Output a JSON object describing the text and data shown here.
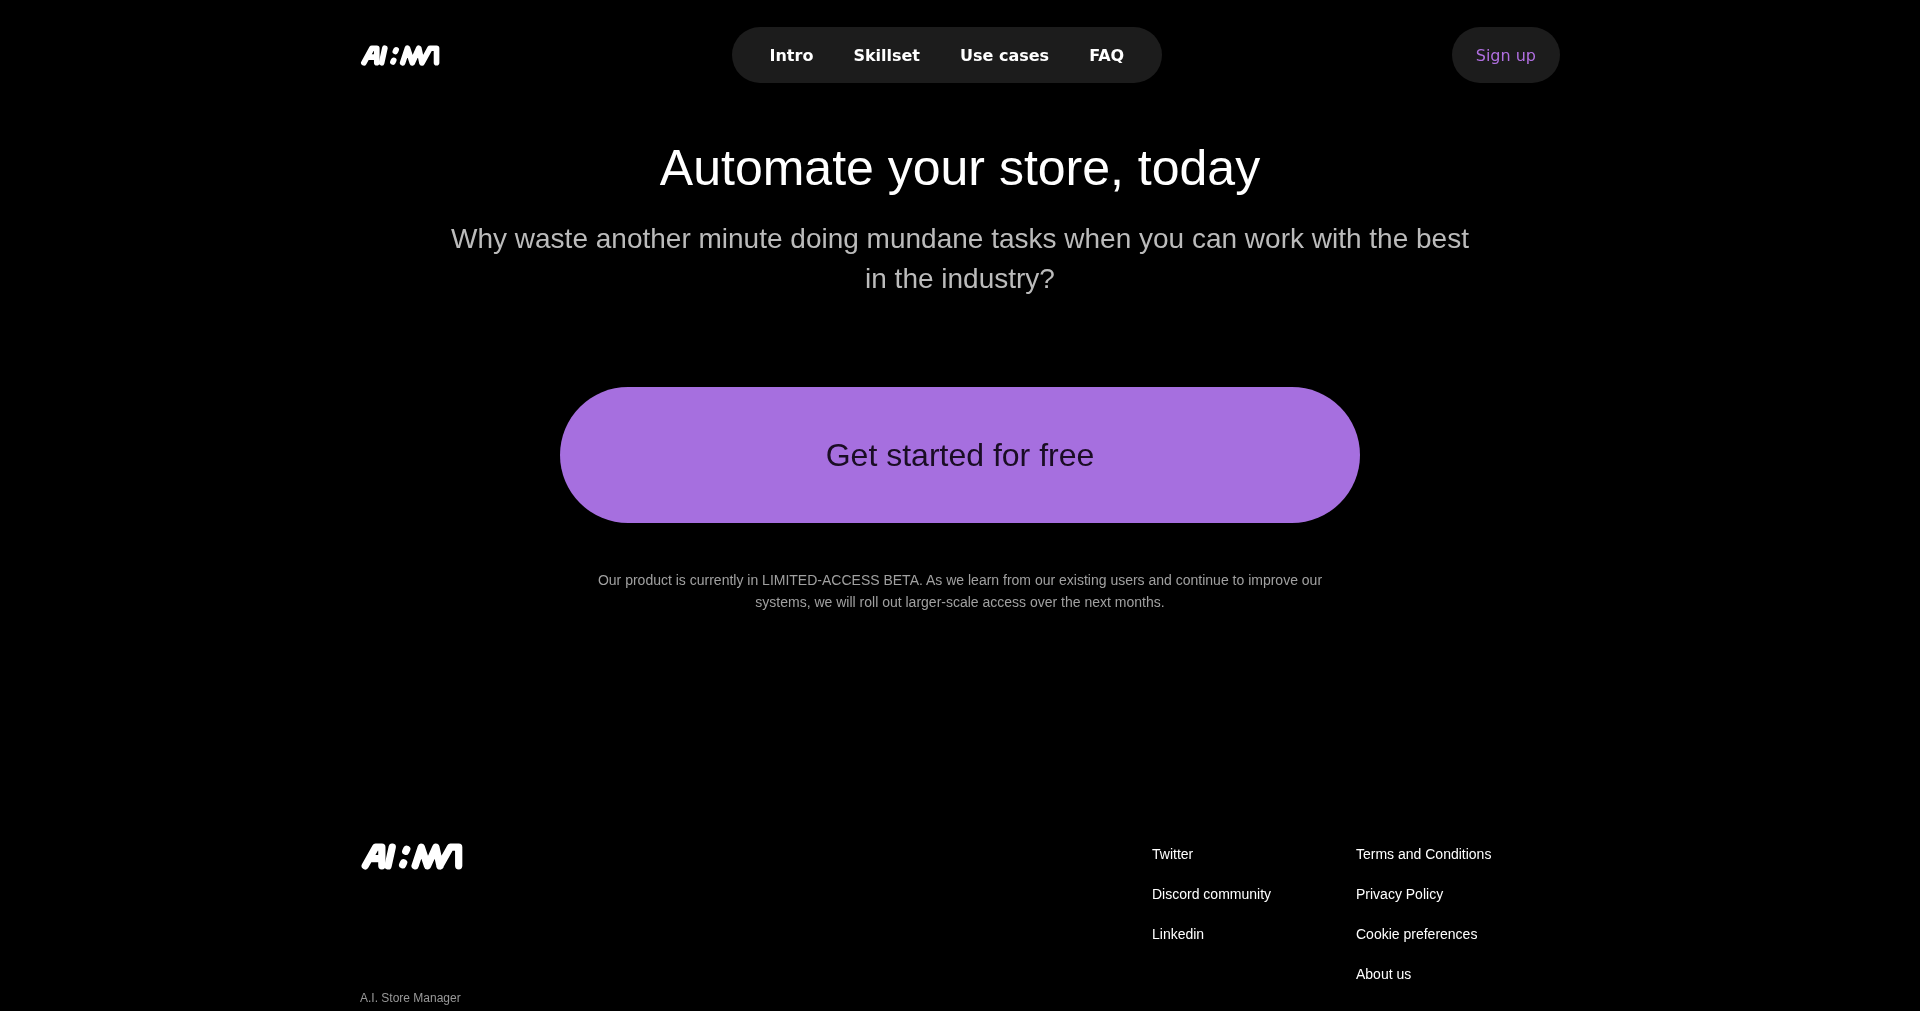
{
  "header": {
    "nav": [
      {
        "label": "Intro"
      },
      {
        "label": "Skillset"
      },
      {
        "label": "Use cases"
      },
      {
        "label": "FAQ"
      }
    ],
    "signup": "Sign up"
  },
  "hero": {
    "title": "Automate your store, today",
    "subtitle": "Why waste another minute doing mundane tasks when you can work with the best in the industry?",
    "cta": "Get started for free",
    "note": "Our product is currently in LIMITED-ACCESS BETA. As we learn from our existing users and continue to improve our systems, we will roll out larger-scale access over the next months."
  },
  "footer": {
    "tagline": "A.I. Store Manager",
    "link_columns": [
      [
        "Twitter",
        "Discord community",
        "Linkedin"
      ],
      [
        "Terms and Conditions",
        "Privacy Policy",
        "Cookie preferences",
        "About us"
      ]
    ]
  }
}
